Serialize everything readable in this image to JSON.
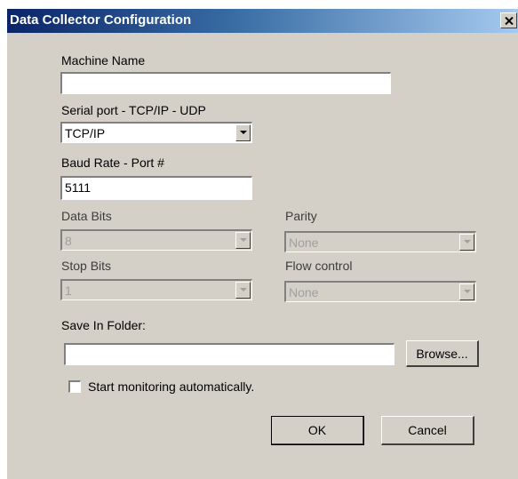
{
  "window": {
    "title": "Data Collector Configuration",
    "close_glyph": "×"
  },
  "fields": {
    "machine_name": {
      "label": "Machine Name",
      "value": ""
    },
    "connection": {
      "label": "Serial port - TCP/IP - UDP",
      "value": "TCP/IP"
    },
    "baud_port": {
      "label": "Baud Rate - Port #",
      "value": "5111"
    },
    "data_bits": {
      "label": "Data Bits",
      "value": "8"
    },
    "parity": {
      "label": "Parity",
      "value": "None"
    },
    "stop_bits": {
      "label": "Stop Bits",
      "value": "1"
    },
    "flow_control": {
      "label": "Flow control",
      "value": "None"
    },
    "save_folder": {
      "label": "Save In Folder:",
      "value": ""
    }
  },
  "buttons": {
    "browse": "Browse...",
    "ok": "OK",
    "cancel": "Cancel"
  },
  "checkbox": {
    "label": "Start monitoring automatically.",
    "checked": false
  },
  "colors": {
    "dialog_bg": "#d4d0c8",
    "title_start": "#0a246a",
    "title_end": "#a6caf0"
  }
}
